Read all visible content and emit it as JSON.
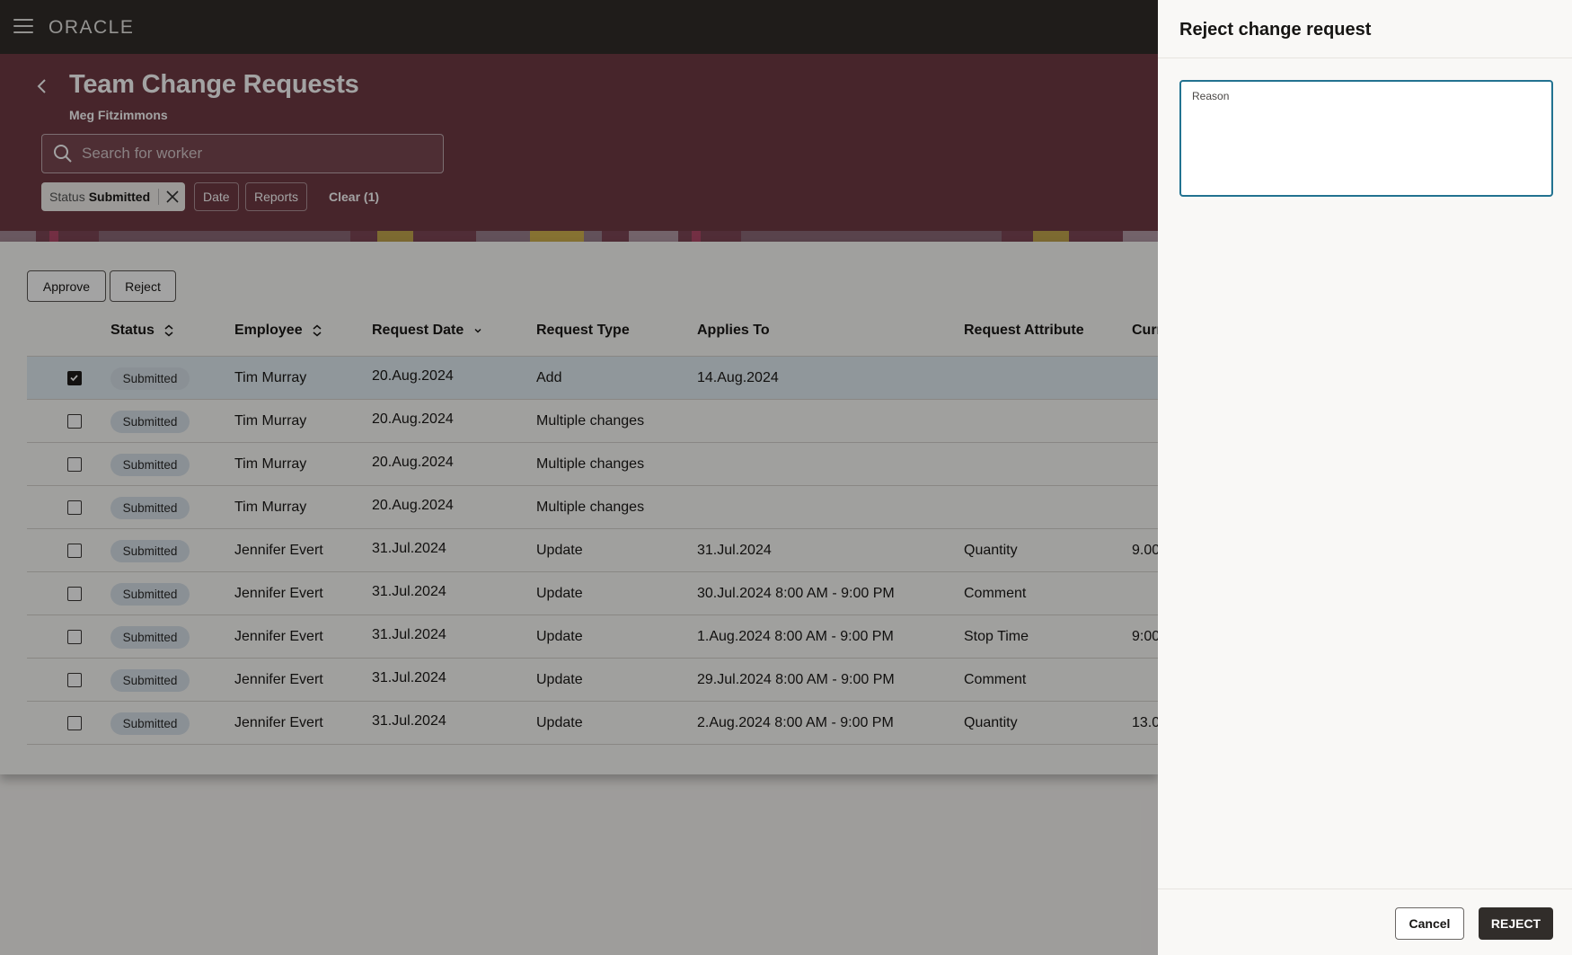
{
  "app": {
    "logo": "ORACLE",
    "title": "Team Change Requests",
    "subtitle": "Meg Fitzimmons"
  },
  "search": {
    "placeholder": "Search for worker",
    "value": ""
  },
  "filters": {
    "status_key": "Status",
    "status_value": "Submitted",
    "date_label": "Date",
    "reports_label": "Reports",
    "clear_label": "Clear (1)"
  },
  "toolbar": {
    "approve_label": "Approve",
    "reject_label": "Reject"
  },
  "table": {
    "columns": [
      "Status",
      "Employee",
      "Request Date",
      "Request Type",
      "Applies To",
      "Request Attribute",
      "Curr"
    ],
    "rows": [
      {
        "selected": true,
        "status": "Submitted",
        "employee": "Tim Murray",
        "request_date": "20.Aug.2024",
        "request_type": "Add",
        "applies_to": "14.Aug.2024",
        "attribute": "",
        "current": ""
      },
      {
        "selected": false,
        "status": "Submitted",
        "employee": "Tim Murray",
        "request_date": "20.Aug.2024",
        "request_type": "Multiple changes",
        "applies_to": "",
        "attribute": "",
        "current": ""
      },
      {
        "selected": false,
        "status": "Submitted",
        "employee": "Tim Murray",
        "request_date": "20.Aug.2024",
        "request_type": "Multiple changes",
        "applies_to": "",
        "attribute": "",
        "current": ""
      },
      {
        "selected": false,
        "status": "Submitted",
        "employee": "Tim Murray",
        "request_date": "20.Aug.2024",
        "request_type": "Multiple changes",
        "applies_to": "",
        "attribute": "",
        "current": ""
      },
      {
        "selected": false,
        "status": "Submitted",
        "employee": "Jennifer Evert",
        "request_date": "31.Jul.2024",
        "request_type": "Update",
        "applies_to": "31.Jul.2024",
        "attribute": "Quantity",
        "current": "9.00"
      },
      {
        "selected": false,
        "status": "Submitted",
        "employee": "Jennifer Evert",
        "request_date": "31.Jul.2024",
        "request_type": "Update",
        "applies_to": "30.Jul.2024 8:00 AM - 9:00 PM",
        "attribute": "Comment",
        "current": ""
      },
      {
        "selected": false,
        "status": "Submitted",
        "employee": "Jennifer Evert",
        "request_date": "31.Jul.2024",
        "request_type": "Update",
        "applies_to": "1.Aug.2024 8:00 AM - 9:00 PM",
        "attribute": "Stop Time",
        "current": "9:00"
      },
      {
        "selected": false,
        "status": "Submitted",
        "employee": "Jennifer Evert",
        "request_date": "31.Jul.2024",
        "request_type": "Update",
        "applies_to": "29.Jul.2024 8:00 AM - 9:00 PM",
        "attribute": "Comment",
        "current": ""
      },
      {
        "selected": false,
        "status": "Submitted",
        "employee": "Jennifer Evert",
        "request_date": "31.Jul.2024",
        "request_type": "Update",
        "applies_to": "2.Aug.2024 8:00 AM - 9:00 PM",
        "attribute": "Quantity",
        "current": "13.0"
      }
    ]
  },
  "drawer": {
    "title": "Reject change request",
    "reason_label": "Reason",
    "reason_value": "",
    "cancel_label": "Cancel",
    "reject_label": "REJECT"
  },
  "colors": {
    "header_bg": "#312d2a",
    "hero_bg": "#6f3a44",
    "focus_border": "#227290",
    "primary_button": "#312d2a",
    "selected_row": "#e2ecf2",
    "status_badge": "#d8e2e9"
  }
}
